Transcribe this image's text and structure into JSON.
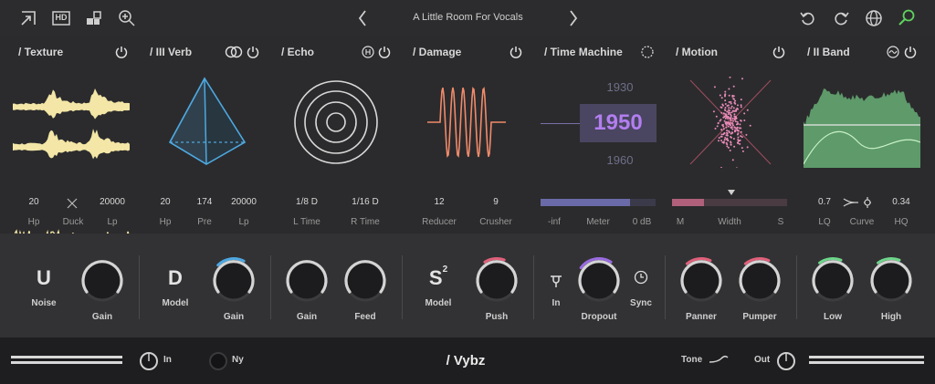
{
  "toolbar": {
    "icons": [
      "resize-icon",
      "hd-icon",
      "randomize-icon",
      "zoom-icon",
      "undo-icon",
      "redo-icon",
      "globe-icon",
      "search-icon"
    ],
    "hd_label": "HD",
    "preset_name": "A Little Room For Vocals"
  },
  "modules": {
    "texture": {
      "title": "/ Texture",
      "values": [
        "20",
        "20000"
      ],
      "labels": [
        "Hp",
        "Duck",
        "Lp"
      ]
    },
    "verb": {
      "title": "/ III Verb",
      "values": [
        "20",
        "174",
        "20000"
      ],
      "labels": [
        "Hp",
        "Pre",
        "Lp"
      ]
    },
    "echo": {
      "title": "/ Echo",
      "values": [
        "1/8 D",
        "1/16 D"
      ],
      "labels": [
        "L Time",
        "R Time"
      ]
    },
    "damage": {
      "title": "/ Damage",
      "values": [
        "12",
        "9"
      ],
      "labels": [
        "Reducer",
        "Crusher"
      ]
    },
    "time_machine": {
      "title": "/ Time Machine",
      "years": [
        "1930",
        "1950",
        "1960"
      ],
      "labels": [
        "-inf",
        "Meter",
        "0 dB"
      ],
      "meter_level": 0.78
    },
    "motion": {
      "title": "/ Motion",
      "labels": [
        "M",
        "Width",
        "S"
      ],
      "width_level": 0.28
    },
    "band": {
      "title": "/ II Band",
      "values": [
        "0.7",
        "0.34"
      ],
      "labels": [
        "LQ",
        "Curve",
        "HQ"
      ]
    }
  },
  "knobs": {
    "noise": {
      "letter": "U",
      "label": "Noise"
    },
    "gain1": {
      "label": "Gain"
    },
    "model": {
      "letter": "D",
      "label": "Model"
    },
    "gain2": {
      "label": "Gain"
    },
    "gain3": {
      "label": "Gain"
    },
    "feed": {
      "label": "Feed"
    },
    "model2": {
      "letter": "S",
      "sup": "2",
      "label": "Model"
    },
    "push": {
      "label": "Push"
    },
    "in": {
      "label": "In"
    },
    "dropout": {
      "label": "Dropout"
    },
    "sync": {
      "label": "Sync"
    },
    "panner": {
      "label": "Panner"
    },
    "pumper": {
      "label": "Pumper"
    },
    "low": {
      "label": "Low"
    },
    "high": {
      "label": "High"
    }
  },
  "colors": {
    "accent_blue": "#4ea8e0",
    "accent_pink": "#e0607a",
    "accent_purple": "#9a6be0",
    "accent_green": "#6ed68a",
    "texture_yellow": "#f3e6a6",
    "damage_orange": "#f08a6a",
    "time_purple": "#b27ef0"
  },
  "bottom": {
    "in_label": "In",
    "ny_label": "Ny",
    "brand": "/ Vybz",
    "tone_label": "Tone",
    "out_label": "Out"
  }
}
